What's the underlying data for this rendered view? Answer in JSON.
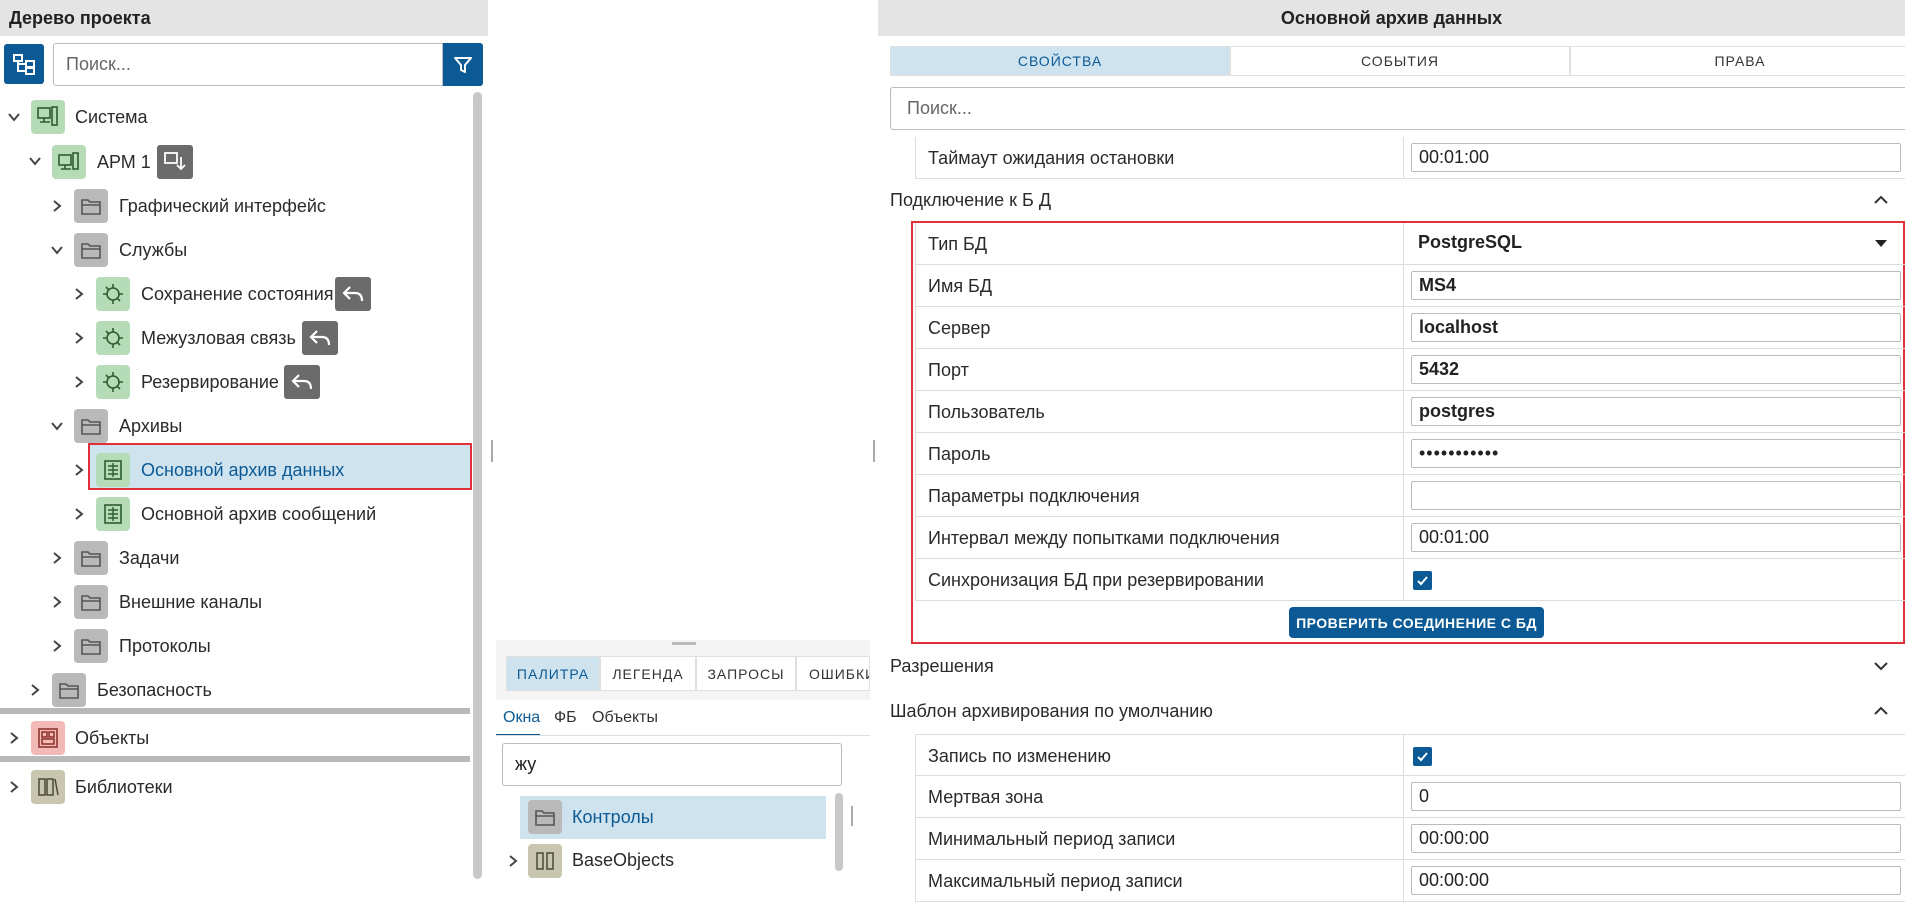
{
  "left_panel": {
    "title": "Дерево проекта",
    "search_placeholder": "Поиск...",
    "tree": {
      "system": "Система",
      "arm": "АРМ 1",
      "graphic_ui": "Графический интерфейс",
      "services": "Службы",
      "state_save": "Сохранение состояния",
      "internode": "Межузловая связь",
      "reservation": "Резервирование",
      "archives": "Архивы",
      "main_data_archive": "Основной архив данных",
      "main_msg_archive": "Основной архив сообщений",
      "tasks": "Задачи",
      "external_channels": "Внешние каналы",
      "protocols": "Протоколы",
      "security": "Безопасность",
      "objects": "Объекты",
      "libraries": "Библиотеки"
    }
  },
  "middle_panel": {
    "tabs": [
      "ПАЛИТРА",
      "ЛЕГЕНДА",
      "ЗАПРОСЫ",
      "ОШИБКИ"
    ],
    "subtabs": [
      "Окна",
      "ФБ",
      "Объекты"
    ],
    "search_value": "жу",
    "items": [
      "Контролы",
      "BaseObjects"
    ]
  },
  "right_panel": {
    "title": "Основной архив данных",
    "tabs": [
      "СВОЙСТВА",
      "СОБЫТИЯ",
      "ПРАВА"
    ],
    "search_placeholder": "Поиск...",
    "stop_timeout": {
      "label": "Таймаут ожидания остановки",
      "value": "00:01:00"
    },
    "db_section": {
      "title": "Подключение к Б Д",
      "db_type": {
        "label": "Тип БД",
        "value": "PostgreSQL"
      },
      "db_name": {
        "label": "Имя БД",
        "value": "MS4"
      },
      "server": {
        "label": "Сервер",
        "value": "localhost"
      },
      "port": {
        "label": "Порт",
        "value": "5432"
      },
      "user": {
        "label": "Пользователь",
        "value": "postgres"
      },
      "password": {
        "label": "Пароль",
        "value": "•••••••••••"
      },
      "conn_params": {
        "label": "Параметры подключения",
        "value": ""
      },
      "retry_interval": {
        "label": "Интервал между попытками подключения",
        "value": "00:01:00"
      },
      "sync": {
        "label": "Синхронизация БД при резервировании",
        "checked": true
      },
      "check_button": "ПРОВЕРИТЬ СОЕДИНЕНИЕ С БД"
    },
    "permissions_section": {
      "title": "Разрешения"
    },
    "template_section": {
      "title": "Шаблон архивирования по умолчанию",
      "on_change": {
        "label": "Запись по изменению",
        "checked": true
      },
      "dead_zone": {
        "label": "Мертвая зона",
        "value": "0"
      },
      "min_period": {
        "label": "Минимальный период записи",
        "value": "00:00:00"
      },
      "max_period": {
        "label": "Максимальный период записи",
        "value": "00:00:00"
      }
    }
  },
  "colors": {
    "accent": "#0b5a96",
    "selection": "#cfe3ee",
    "highlight_border": "#e0313a"
  }
}
